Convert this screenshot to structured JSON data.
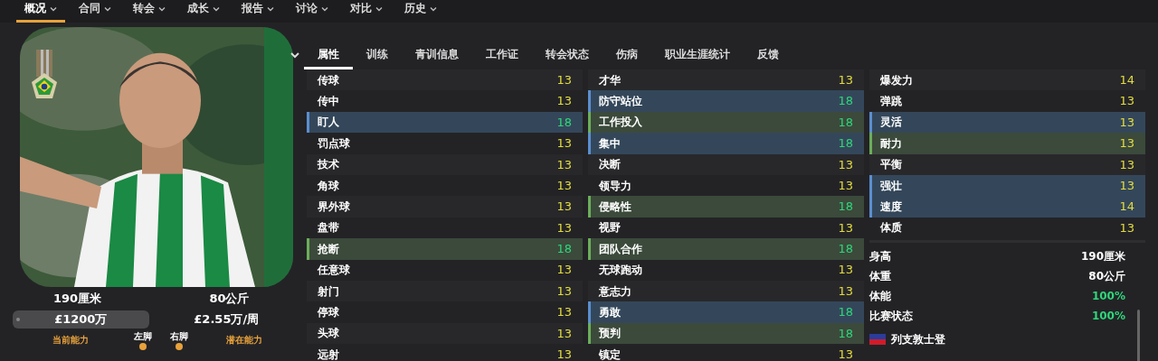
{
  "nav": [
    {
      "label": "概况",
      "selected": true
    },
    {
      "label": "合同",
      "selected": false
    },
    {
      "label": "转会",
      "selected": false
    },
    {
      "label": "成长",
      "selected": false
    },
    {
      "label": "报告",
      "selected": false
    },
    {
      "label": "讨论",
      "selected": false
    },
    {
      "label": "对比",
      "selected": false
    },
    {
      "label": "历史",
      "selected": false
    }
  ],
  "player": {
    "height": "190厘米",
    "weight": "80公斤",
    "value": "£1200万",
    "wage": "£2.55万/周",
    "footer": [
      {
        "label": "当前能力",
        "kind": "ability"
      },
      {
        "label": "左脚",
        "kind": "foot"
      },
      {
        "label": "右脚",
        "kind": "foot"
      },
      {
        "label": "潜在能力",
        "kind": "ability"
      }
    ]
  },
  "tabs": [
    {
      "label": "属性",
      "selected": true
    },
    {
      "label": "训练",
      "selected": false
    },
    {
      "label": "青训信息",
      "selected": false
    },
    {
      "label": "工作证",
      "selected": false
    },
    {
      "label": "转会状态",
      "selected": false
    },
    {
      "label": "伤病",
      "selected": false
    },
    {
      "label": "职业生涯统计",
      "selected": false
    },
    {
      "label": "反馈",
      "selected": false
    }
  ],
  "attribute_columns": [
    [
      {
        "name": "传球",
        "value": "13",
        "kind": "plain",
        "color": "#e3dc3f"
      },
      {
        "name": "传中",
        "value": "13",
        "kind": "plain",
        "color": "#e3dc3f"
      },
      {
        "name": "盯人",
        "value": "18",
        "kind": "key",
        "color": "#2fd67a"
      },
      {
        "name": "罚点球",
        "value": "13",
        "kind": "plain",
        "color": "#e3dc3f"
      },
      {
        "name": "技术",
        "value": "13",
        "kind": "plain",
        "color": "#e3dc3f"
      },
      {
        "name": "角球",
        "value": "13",
        "kind": "plain",
        "color": "#e3dc3f"
      },
      {
        "name": "界外球",
        "value": "13",
        "kind": "plain",
        "color": "#e3dc3f"
      },
      {
        "name": "盘带",
        "value": "13",
        "kind": "plain",
        "color": "#e3dc3f"
      },
      {
        "name": "抢断",
        "value": "18",
        "kind": "preferred",
        "color": "#2fd67a"
      },
      {
        "name": "任意球",
        "value": "13",
        "kind": "plain",
        "color": "#e3dc3f"
      },
      {
        "name": "射门",
        "value": "13",
        "kind": "plain",
        "color": "#e3dc3f"
      },
      {
        "name": "停球",
        "value": "13",
        "kind": "plain",
        "color": "#e3dc3f"
      },
      {
        "name": "头球",
        "value": "13",
        "kind": "plain",
        "color": "#e3dc3f"
      },
      {
        "name": "远射",
        "value": "13",
        "kind": "plain",
        "color": "#e3dc3f"
      }
    ],
    [
      {
        "name": "才华",
        "value": "13",
        "kind": "plain",
        "color": "#e3dc3f"
      },
      {
        "name": "防守站位",
        "value": "18",
        "kind": "key",
        "color": "#2fd67a"
      },
      {
        "name": "工作投入",
        "value": "18",
        "kind": "preferred",
        "color": "#2fd67a"
      },
      {
        "name": "集中",
        "value": "18",
        "kind": "key",
        "color": "#2fd67a"
      },
      {
        "name": "决断",
        "value": "13",
        "kind": "plain",
        "color": "#e3dc3f"
      },
      {
        "name": "领导力",
        "value": "13",
        "kind": "plain",
        "color": "#e3dc3f"
      },
      {
        "name": "侵略性",
        "value": "18",
        "kind": "preferred",
        "color": "#2fd67a"
      },
      {
        "name": "视野",
        "value": "13",
        "kind": "plain",
        "color": "#e3dc3f"
      },
      {
        "name": "团队合作",
        "value": "18",
        "kind": "preferred",
        "color": "#2fd67a"
      },
      {
        "name": "无球跑动",
        "value": "13",
        "kind": "plain",
        "color": "#e3dc3f"
      },
      {
        "name": "意志力",
        "value": "13",
        "kind": "plain",
        "color": "#e3dc3f"
      },
      {
        "name": "勇敢",
        "value": "18",
        "kind": "key",
        "color": "#2fd67a"
      },
      {
        "name": "预判",
        "value": "18",
        "kind": "preferred",
        "color": "#2fd67a"
      },
      {
        "name": "镇定",
        "value": "13",
        "kind": "plain",
        "color": "#e3dc3f"
      }
    ],
    [
      {
        "name": "爆发力",
        "value": "14",
        "kind": "plain",
        "color": "#e3dc3f"
      },
      {
        "name": "弹跳",
        "value": "13",
        "kind": "plain",
        "color": "#e3dc3f"
      },
      {
        "name": "灵活",
        "value": "13",
        "kind": "key",
        "color": "#e3dc3f"
      },
      {
        "name": "耐力",
        "value": "13",
        "kind": "preferred",
        "color": "#e3dc3f"
      },
      {
        "name": "平衡",
        "value": "13",
        "kind": "plain",
        "color": "#e3dc3f"
      },
      {
        "name": "强壮",
        "value": "13",
        "kind": "key",
        "color": "#e3dc3f"
      },
      {
        "name": "速度",
        "value": "14",
        "kind": "key",
        "color": "#e3dc3f"
      },
      {
        "name": "体质",
        "value": "13",
        "kind": "plain",
        "color": "#e3dc3f"
      }
    ]
  ],
  "info": [
    {
      "label": "身高",
      "value": "190厘米",
      "color": "#ffffff"
    },
    {
      "label": "体重",
      "value": "80公斤",
      "color": "#ffffff"
    },
    {
      "label": "体能",
      "value": "100%",
      "color": "#2fd67a"
    },
    {
      "label": "比赛状态",
      "value": "100%",
      "color": "#2fd67a"
    }
  ],
  "nationality": "列支敦士登"
}
